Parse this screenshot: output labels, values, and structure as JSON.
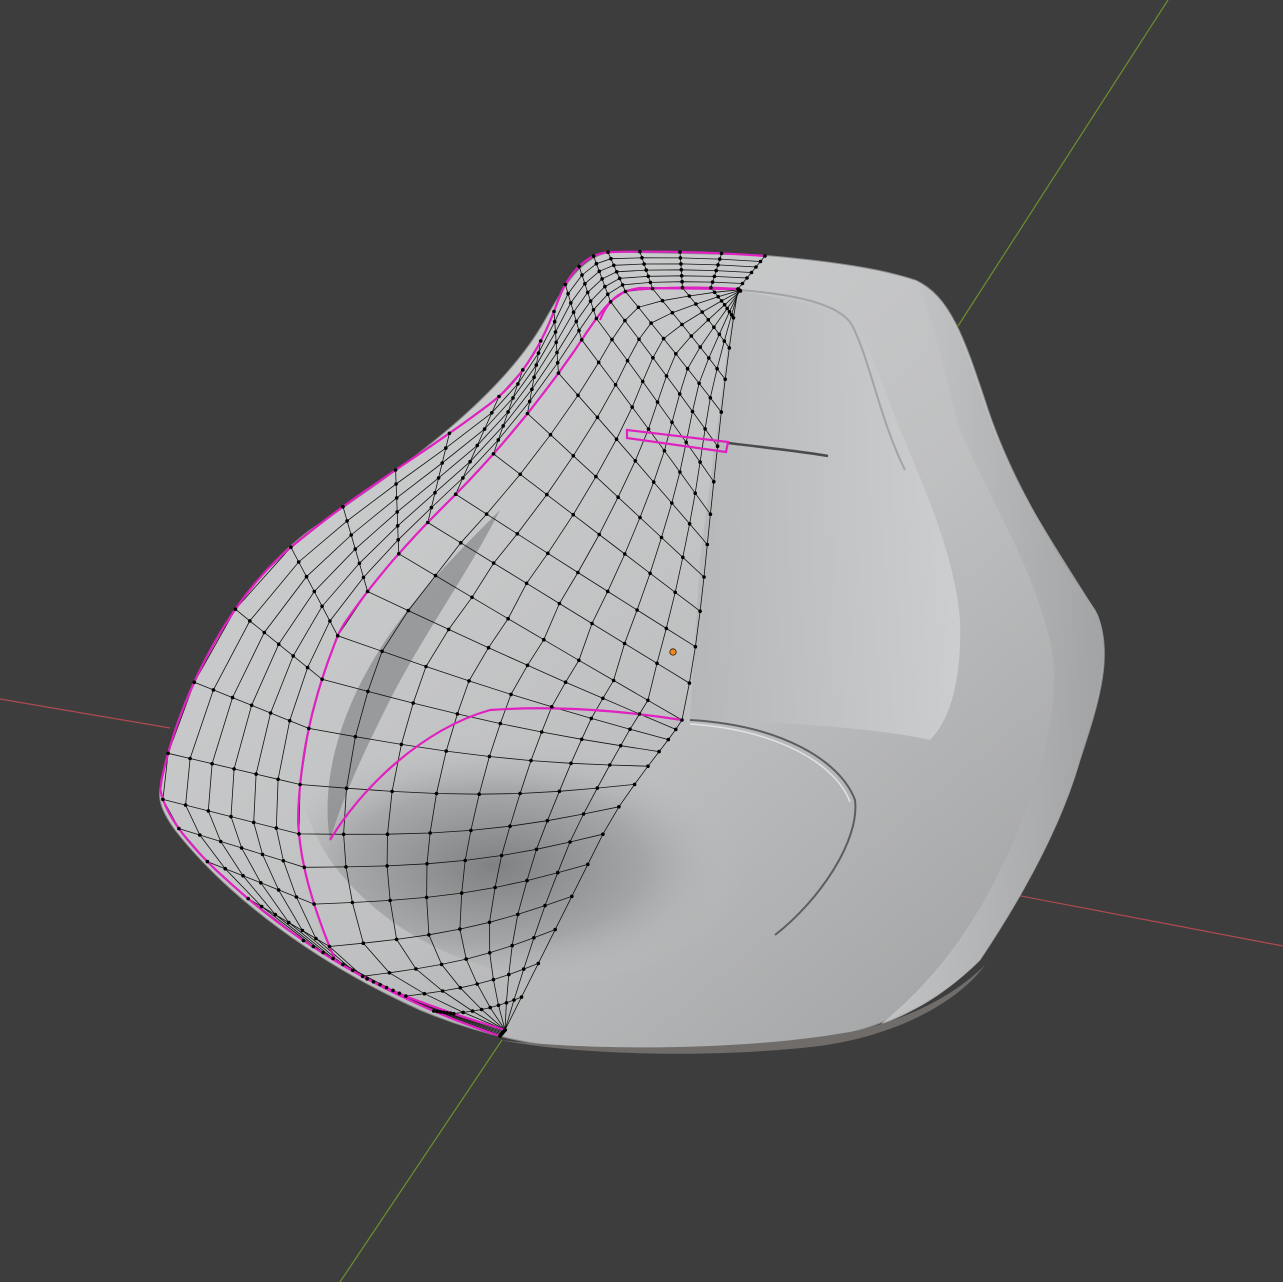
{
  "viewport": {
    "editor": "3D Viewport",
    "mode": "edit-mode",
    "shading": "solid",
    "colors": {
      "background": "#3d3d3d",
      "x_axis": "#b04a52",
      "y_axis": "#6b8f2e",
      "surface_light": "#c9cacb",
      "surface_mid": "#a9aaab",
      "surface_dark": "#6a6b6c",
      "wire": "#111111",
      "vertex": "#000000",
      "seam": "#e020c0",
      "origin": "#f08a1c"
    },
    "object": {
      "type": "chair-shell-mesh",
      "modifiers": [
        "mirror",
        "subdivision-surface"
      ],
      "marked_seams": 5
    }
  }
}
